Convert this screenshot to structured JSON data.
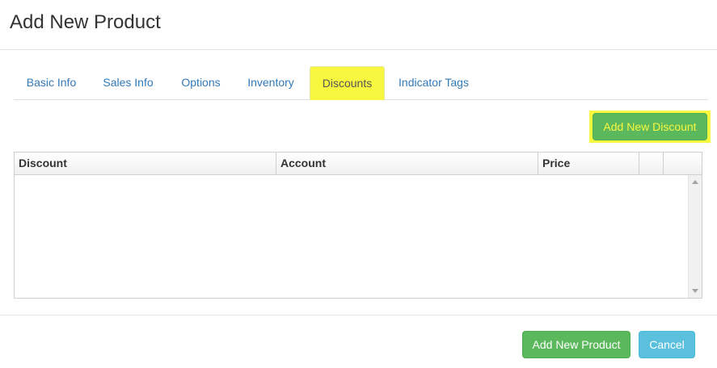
{
  "modal": {
    "title": "Add New Product"
  },
  "tabs": [
    {
      "label": "Basic Info",
      "active": false
    },
    {
      "label": "Sales Info",
      "active": false
    },
    {
      "label": "Options",
      "active": false
    },
    {
      "label": "Inventory",
      "active": false
    },
    {
      "label": "Discounts",
      "active": true
    },
    {
      "label": "Indicator Tags",
      "active": false
    }
  ],
  "discounts": {
    "add_button_label": "Add New Discount",
    "columns": [
      "Discount",
      "Account",
      "Price",
      "",
      ""
    ],
    "rows": []
  },
  "footer": {
    "add_product_label": "Add New Product",
    "cancel_label": "Cancel"
  },
  "colors": {
    "highlight": "#f7f740",
    "primary_green": "#5cb85c",
    "info_blue": "#5bc0de",
    "link_blue": "#337ab7"
  },
  "icons": {
    "scroll_up": "chevron-up-icon",
    "scroll_down": "chevron-down-icon"
  }
}
